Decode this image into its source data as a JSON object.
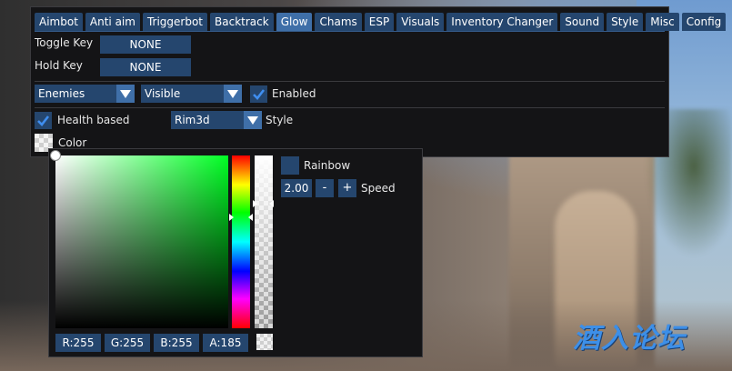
{
  "tabs": [
    {
      "label": "Aimbot"
    },
    {
      "label": "Anti aim"
    },
    {
      "label": "Triggerbot"
    },
    {
      "label": "Backtrack"
    },
    {
      "label": "Glow",
      "active": true
    },
    {
      "label": "Chams"
    },
    {
      "label": "ESP"
    },
    {
      "label": "Visuals"
    },
    {
      "label": "Inventory Changer"
    },
    {
      "label": "Sound"
    },
    {
      "label": "Style"
    },
    {
      "label": "Misc"
    },
    {
      "label": "Config"
    }
  ],
  "glow": {
    "toggle_key_label": "Toggle Key",
    "toggle_key_value": "NONE",
    "hold_key_label": "Hold Key",
    "hold_key_value": "NONE",
    "category_value": "Enemies",
    "visibility_value": "Visible",
    "enabled_label": "Enabled",
    "enabled_checked": true,
    "health_based_label": "Health based",
    "health_based_checked": true,
    "style_value": "Rim3d",
    "style_label": "Style",
    "color_label": "Color"
  },
  "color_picker": {
    "r_text": "R:255",
    "g_text": "G:255",
    "b_text": "B:255",
    "a_text": "A:185",
    "rainbow_label": "Rainbow",
    "rainbow_checked": false,
    "speed_value": "2.00",
    "minus_label": "-",
    "plus_label": "+",
    "speed_label": "Speed"
  },
  "watermark_text": "酒入论坛",
  "colors": {
    "accent": "#25466e",
    "accent_active": "#3f6fa8",
    "panel_bg": "#141416",
    "hue_marker_fraction": 0.37,
    "alpha_marker_fraction": 0.27
  }
}
